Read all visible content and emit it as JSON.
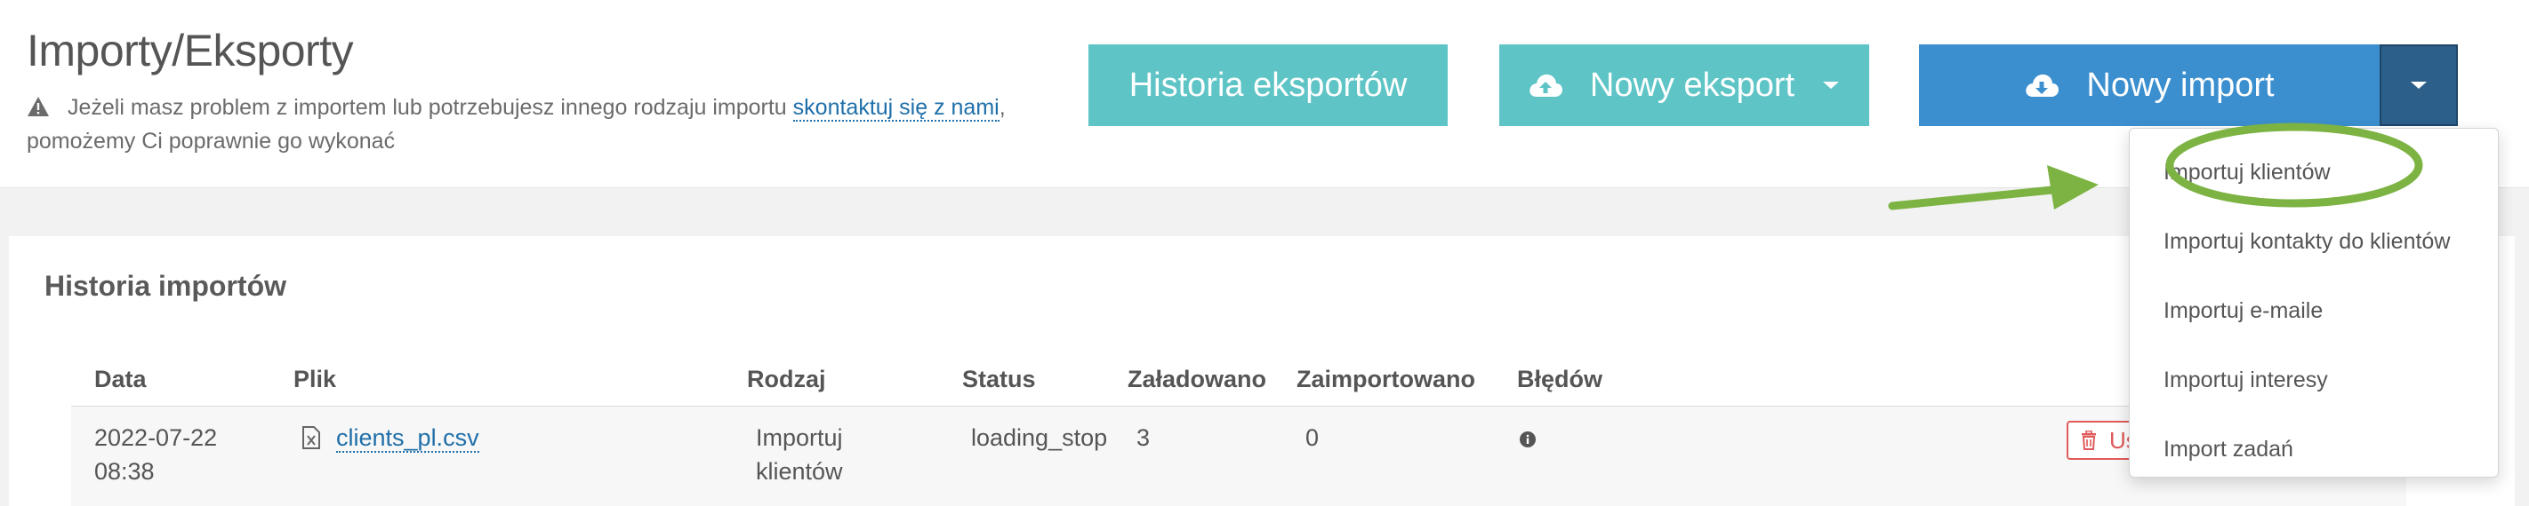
{
  "page": {
    "title": "Importy/Eksporty",
    "notice_text": "Jeżeli masz problem z importem lub potrzebujesz innego rodzaju importu",
    "notice_link": "skontaktuj się z nami",
    "notice_comma": ",",
    "notice_text_2": "pomożemy Ci poprawnie go wykonać"
  },
  "toolbar": {
    "history_exports_label": "Historia eksportów",
    "new_export_label": "Nowy eksport",
    "new_import_label": "Nowy import"
  },
  "import_history": {
    "title": "Historia importów",
    "columns": [
      "Data",
      "Plik",
      "Rodzaj",
      "Status",
      "Załadowano",
      "Zaimportowano",
      "Błędów"
    ],
    "rows": [
      {
        "date": "2022-07-22",
        "time": "08:38",
        "file": "clients_pl.csv",
        "type_line1": "Importuj",
        "type_line2": "klientów",
        "status": "loading_stop",
        "loaded": "3",
        "imported": "0",
        "delete_label": "Usuń"
      }
    ]
  },
  "import_menu": {
    "items": [
      "Importuj klientów",
      "Importuj kontakty do klientów",
      "Importuj e-maile",
      "Importuj interesy",
      "Import zadań"
    ]
  },
  "colors": {
    "teal_button": "#5ec4c6",
    "import_button": "#3b8fcf",
    "import_toggle": "#2c5f8a",
    "link": "#1f6fa9",
    "annotation": "#7cb342",
    "danger": "#e05a5a"
  },
  "icons": {
    "warning": "warning-icon",
    "cloud_upload": "cloud-upload-icon",
    "cloud_download": "cloud-download-icon",
    "caret": "caret-down-icon",
    "file": "file-excel-icon",
    "info": "info-icon",
    "trash": "trash-icon"
  }
}
